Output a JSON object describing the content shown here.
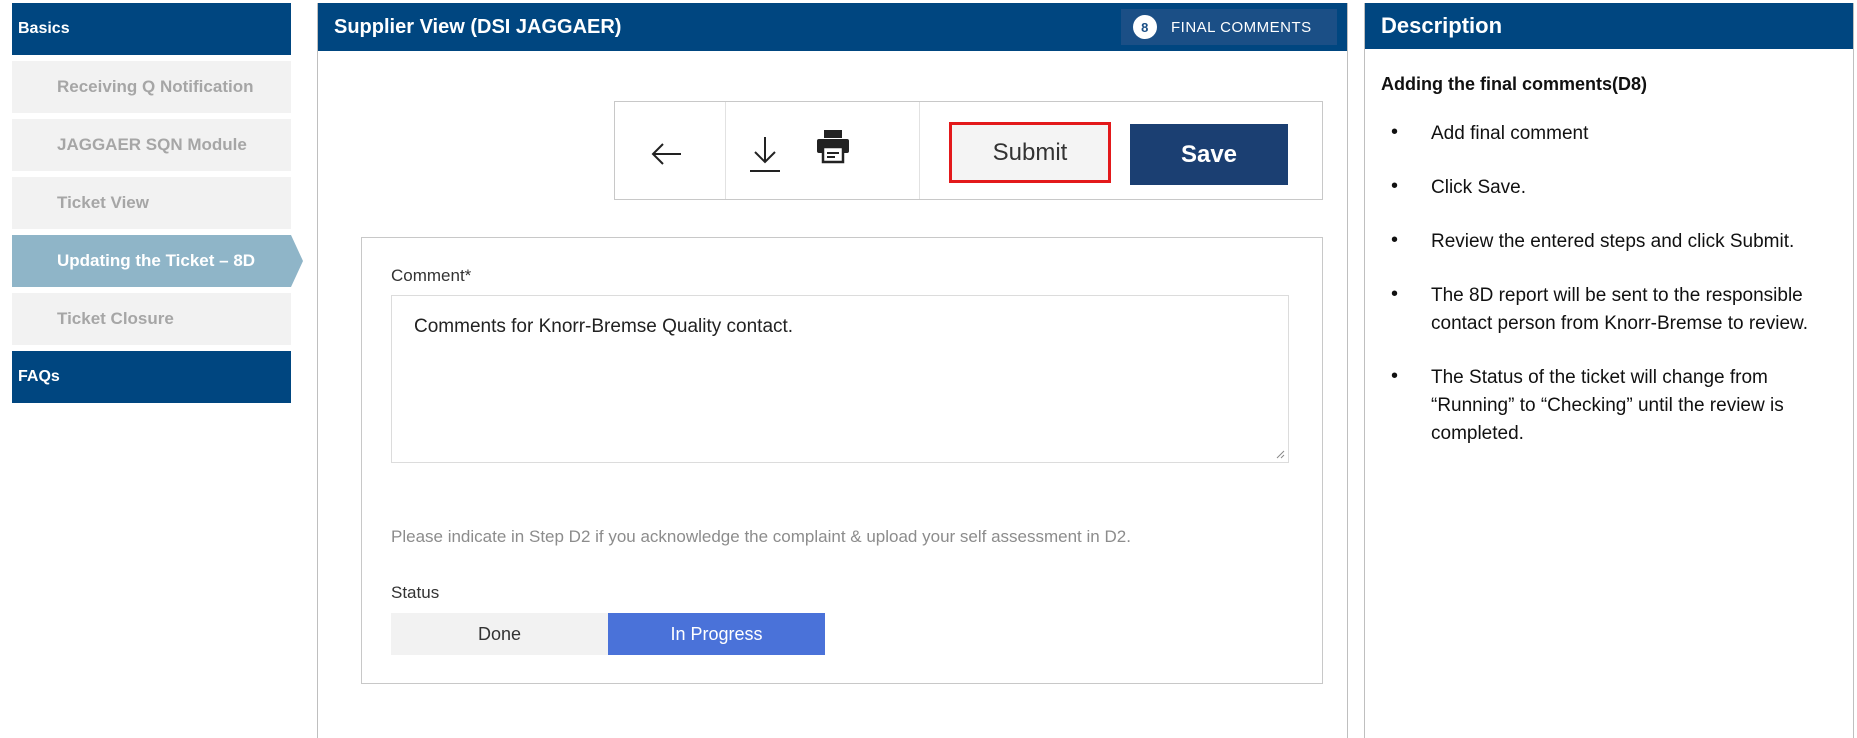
{
  "nav": {
    "basics": "Basics",
    "items": [
      "Receiving Q Notification",
      "JAGGAER SQN Module",
      "Ticket View",
      "Updating the Ticket – 8D",
      "Ticket Closure"
    ],
    "faqs": "FAQs"
  },
  "supplier": {
    "title": "Supplier View (DSI JAGGAER)",
    "step_number": "8",
    "step_label": "FINAL COMMENTS",
    "toolbar": {
      "back_icon": "arrow-left-icon",
      "download_icon": "download-icon",
      "print_icon": "printer-icon",
      "submit_label": "Submit",
      "save_label": "Save"
    },
    "form": {
      "comment_label": "Comment*",
      "comment_value": "Comments for Knorr-Bremse Quality contact.",
      "hint": "Please indicate in Step D2 if you acknowledge the complaint & upload your self assessment in D2.",
      "status_label": "Status",
      "status_options": [
        "Done",
        "In Progress"
      ],
      "status_selected": "In Progress"
    }
  },
  "description": {
    "header": "Description",
    "title": "Adding the final comments(D8)",
    "bullets": [
      "Add final comment",
      "Click Save.",
      "Review the entered steps and click Submit.",
      "The 8D report will be sent to the responsible contact person from Knorr-Bremse to review.",
      "The Status of the ticket will change from “Running” to “Checking” until the review is completed."
    ]
  },
  "colors": {
    "header_blue": "#004680",
    "active_nav": "#8fb5c8",
    "save_button": "#1b3f72",
    "submit_highlight": "#e3191b",
    "status_selected": "#4a72d9"
  }
}
